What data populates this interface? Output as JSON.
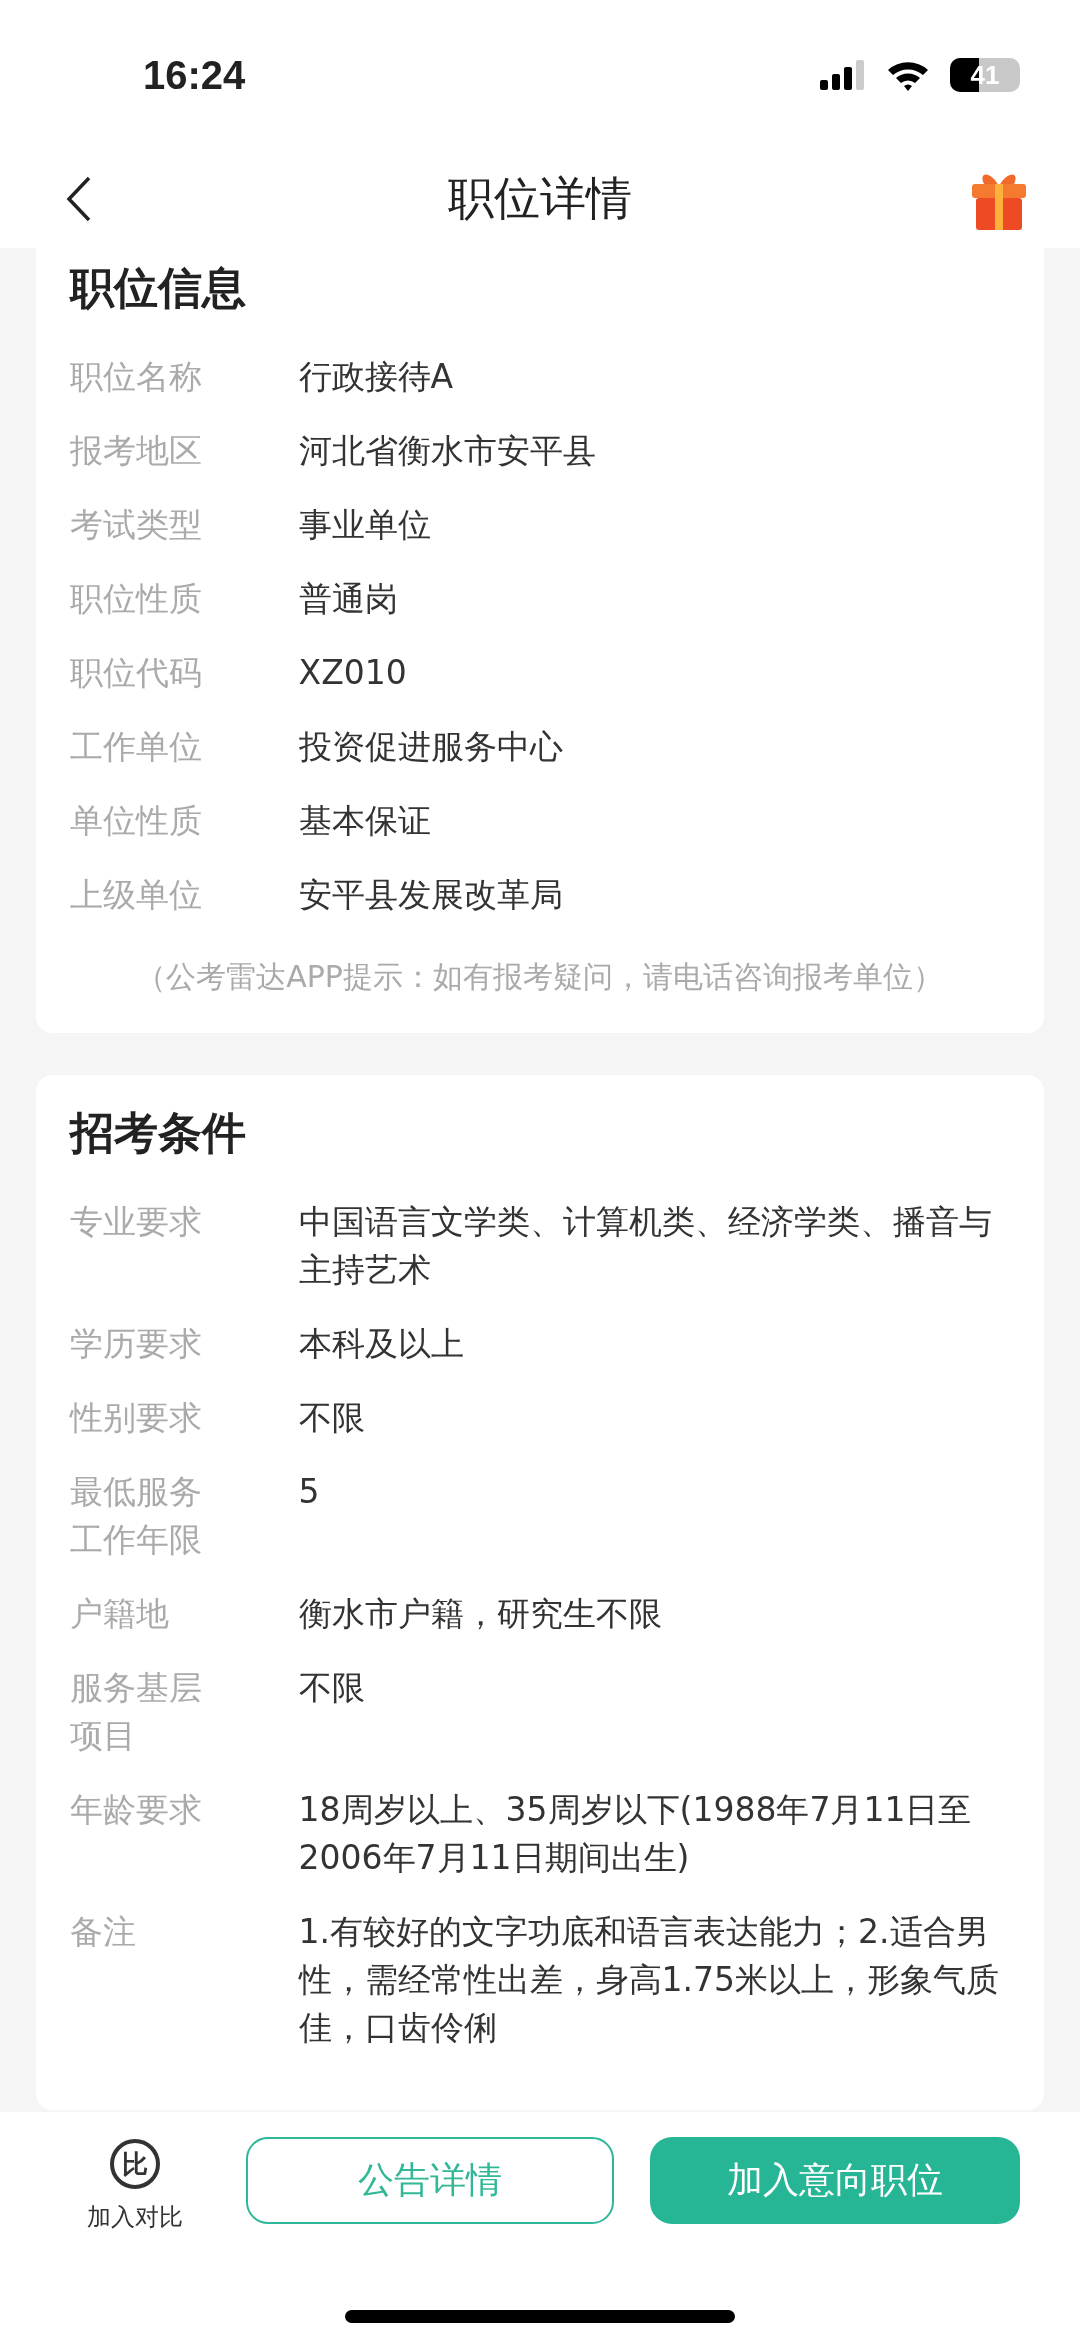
{
  "status_bar": {
    "time": "16:24",
    "battery": "41"
  },
  "header": {
    "title": "职位详情"
  },
  "sections": [
    {
      "title": "职位信息",
      "rows": [
        {
          "label": "职位名称",
          "value": "行政接待A"
        },
        {
          "label": "报考地区",
          "value": "河北省衡水市安平县"
        },
        {
          "label": "考试类型",
          "value": "事业单位"
        },
        {
          "label": "职位性质",
          "value": "普通岗"
        },
        {
          "label": "职位代码",
          "value": "XZ010"
        },
        {
          "label": "工作单位",
          "value": "投资促进服务中心"
        },
        {
          "label": "单位性质",
          "value": "基本保证"
        },
        {
          "label": "上级单位",
          "value": "安平县发展改革局"
        }
      ],
      "hint": "（公考雷达APP提示：如有报考疑问，请电话咨询报考单位）"
    },
    {
      "title": "招考条件",
      "rows": [
        {
          "label": "专业要求",
          "value": "中国语言文学类、计算机类、经济学类、播音与主持艺术"
        },
        {
          "label": "学历要求",
          "value": "本科及以上"
        },
        {
          "label": "性别要求",
          "value": "不限"
        },
        {
          "label": "最低服务工作年限",
          "value": "5"
        },
        {
          "label": "户籍地",
          "value": "衡水市户籍，研究生不限"
        },
        {
          "label": "服务基层项目",
          "value": "不限"
        },
        {
          "label": "年龄要求",
          "value": "18周岁以上、35周岁以下(1988年7月11日至2006年7月11日期间出生)"
        },
        {
          "label": "备注",
          "value": "1.有较好的文字功底和语言表达能力；2.适合男性，需经常性出差，身高1.75米以上，形象气质佳，口齿伶俐"
        }
      ]
    }
  ],
  "bottom_bar": {
    "compare": {
      "icon": "比",
      "label": "加入对比"
    },
    "buttons": [
      {
        "label": "公告详情",
        "kind": "outline"
      },
      {
        "label": "加入意向职位",
        "kind": "filled"
      }
    ]
  }
}
